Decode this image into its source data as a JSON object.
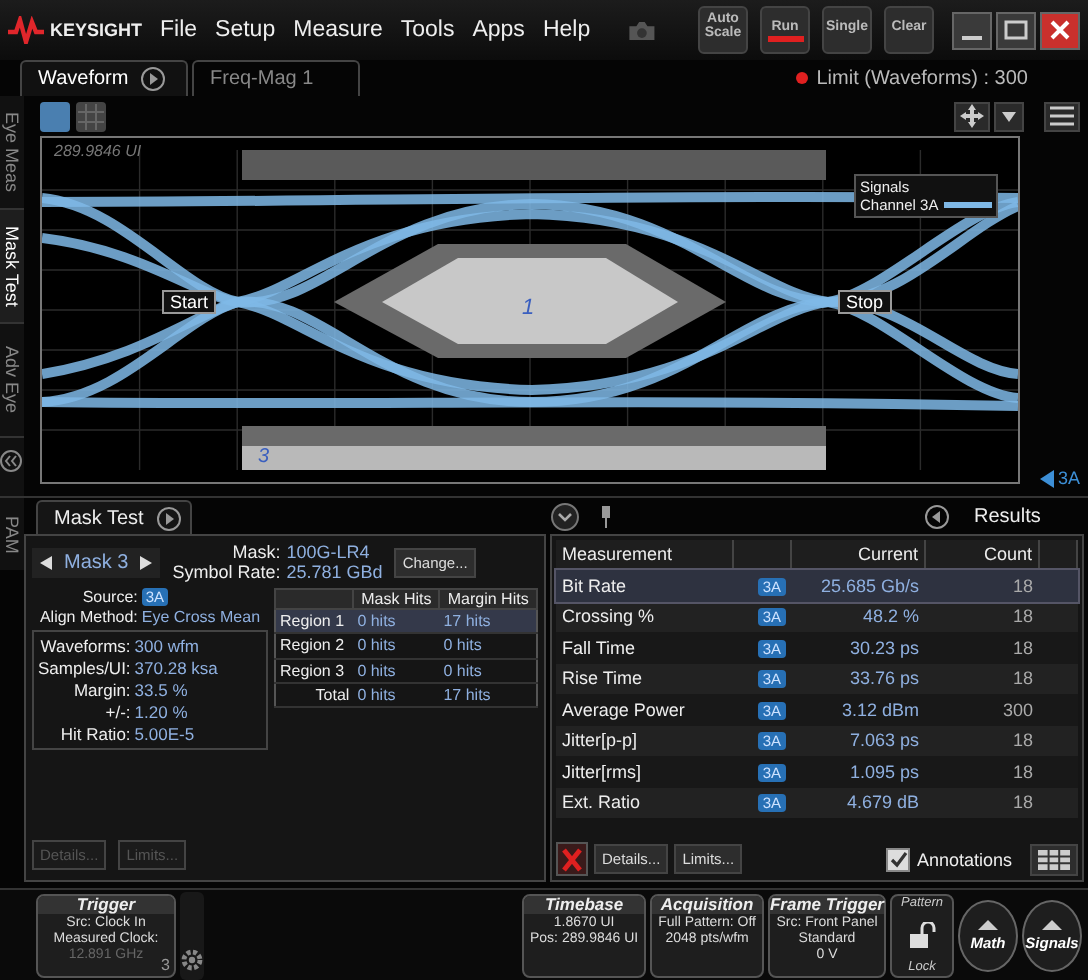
{
  "title_bar": {
    "brand": "KEYSIGHT",
    "menu": [
      "File",
      "Setup",
      "Measure",
      "Tools",
      "Apps",
      "Help"
    ],
    "buttons": [
      {
        "label": "Auto Scale",
        "lit": false
      },
      {
        "label": "Run",
        "lit": true
      },
      {
        "label": "Single",
        "lit": false
      },
      {
        "label": "Clear",
        "lit": false
      }
    ]
  },
  "tabs": [
    {
      "label": "Waveform",
      "selected": true
    },
    {
      "label": "Freq-Mag 1",
      "selected": false
    }
  ],
  "limit_status": "Limit (Waveforms) : 300",
  "side_tabs": [
    {
      "label": "Eye Meas",
      "selected": false
    },
    {
      "label": "Mask Test",
      "selected": true
    },
    {
      "label": "Adv Eye",
      "selected": false
    }
  ],
  "waveform": {
    "position_label": "289.9846 UI",
    "start_marker": "Start",
    "stop_marker": "Stop",
    "mask_regions": [
      "1",
      "3"
    ],
    "legend": {
      "title": "Signals",
      "channel": "Channel 3A"
    },
    "channel_marker": "3A"
  },
  "pam_tab": "PAM",
  "mask_panel": {
    "title": "Mask Test",
    "mask_name": "Mask 3",
    "mask_label": "Mask:",
    "mask_value": "100G-LR4",
    "rate_label": "Symbol Rate:",
    "rate_value": "25.781 GBd",
    "change_button": "Change...",
    "params_top": [
      {
        "label": "Source:",
        "value": "3A",
        "kind": "badge"
      },
      {
        "label": "Align Method:",
        "value": "Eye Cross Mean",
        "kind": "text"
      }
    ],
    "params_box": [
      {
        "label": "Waveforms:",
        "value": "300 wfm"
      },
      {
        "label": "Samples/UI:",
        "value": "370.28 ksa"
      },
      {
        "label": "Margin:",
        "value": "33.5 %"
      },
      {
        "label": "+/-:",
        "value": "1.20 %"
      },
      {
        "label": "Hit Ratio:",
        "value": "5.00E-5"
      }
    ],
    "table": {
      "columns": [
        "Mask Hits",
        "Margin Hits"
      ],
      "rows": [
        {
          "label": "Region 1",
          "mask_hits": "0 hits",
          "margin_hits": "17 hits",
          "selected": true
        },
        {
          "label": "Region 2",
          "mask_hits": "0 hits",
          "margin_hits": "0 hits",
          "selected": false
        },
        {
          "label": "Region 3",
          "mask_hits": "0 hits",
          "margin_hits": "0 hits",
          "selected": false
        },
        {
          "label": "Total",
          "mask_hits": "0 hits",
          "margin_hits": "17 hits",
          "selected": false
        }
      ]
    },
    "buttons": [
      {
        "label": "Details...",
        "disabled": true
      },
      {
        "label": "Limits...",
        "disabled": true
      }
    ]
  },
  "results_panel": {
    "title": "Results",
    "columns": [
      "Measurement",
      "Current",
      "Count"
    ],
    "rows": [
      {
        "name": "Bit Rate",
        "source": "3A",
        "current": "25.685 Gb/s",
        "count": "18",
        "selected": true
      },
      {
        "name": "Crossing %",
        "source": "3A",
        "current": "48.2 %",
        "count": "18",
        "selected": false
      },
      {
        "name": "Fall Time",
        "source": "3A",
        "current": "30.23 ps",
        "count": "18",
        "selected": false
      },
      {
        "name": "Rise Time",
        "source": "3A",
        "current": "33.76 ps",
        "count": "18",
        "selected": false
      },
      {
        "name": "Average Power",
        "source": "3A",
        "current": "3.12 dBm",
        "count": "300",
        "selected": false
      },
      {
        "name": "Jitter[p-p]",
        "source": "3A",
        "current": "7.063 ps",
        "count": "18",
        "selected": false
      },
      {
        "name": "Jitter[rms]",
        "source": "3A",
        "current": "1.095 ps",
        "count": "18",
        "selected": false
      },
      {
        "name": "Ext. Ratio",
        "source": "3A",
        "current": "4.679 dB",
        "count": "18",
        "selected": false
      }
    ],
    "buttons": [
      {
        "label": "Details...",
        "disabled": false
      },
      {
        "label": "Limits...",
        "disabled": false
      }
    ],
    "annotations": {
      "label": "Annotations",
      "checked": true
    }
  },
  "bottom_bar": {
    "trigger": {
      "title": "Trigger",
      "lines": [
        "Src: Clock In",
        "Measured Clock:",
        "12.891 GHz"
      ],
      "corner": "3"
    },
    "boxes": [
      {
        "title": "Timebase",
        "lines": [
          "1.8670 UI",
          "Pos: 289.9846 UI"
        ]
      },
      {
        "title": "Acquisition",
        "lines": [
          "Full Pattern: Off",
          "2048 pts/wfm"
        ]
      },
      {
        "title": "Frame Trigger",
        "lines": [
          "Src: Front Panel",
          "Standard",
          "0 V"
        ]
      }
    ],
    "pattern": {
      "title": "Pattern",
      "lock": "Lock"
    },
    "round_buttons": [
      "Math",
      "Signals"
    ]
  }
}
